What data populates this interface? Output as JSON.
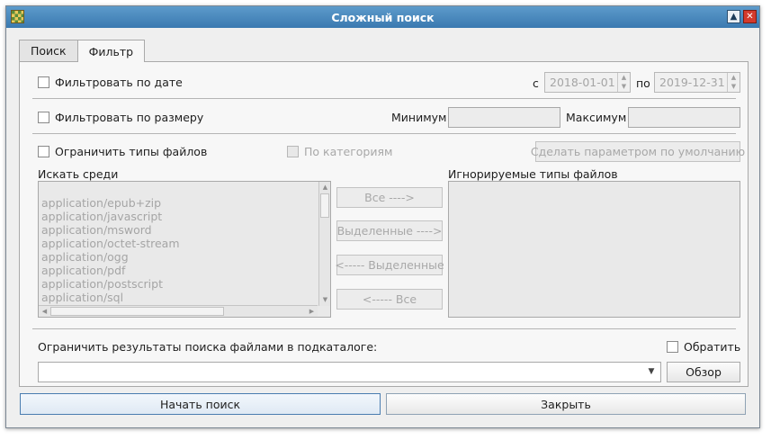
{
  "window": {
    "title": "Сложный поиск",
    "maximize_icon": "arrow-up-icon",
    "close_icon": "close-icon"
  },
  "tabs": [
    {
      "label": "Поиск",
      "active": false
    },
    {
      "label": "Фильтр",
      "active": true
    }
  ],
  "date_filter": {
    "label": "Фильтровать по дате",
    "from_label": "с",
    "from_value": "2018-01-01",
    "to_label": "по",
    "to_value": "2019-12-31"
  },
  "size_filter": {
    "label": "Фильтровать по размеру",
    "min_label": "Минимум",
    "min_value": "",
    "max_label": "Максимум",
    "max_value": ""
  },
  "type_filter": {
    "label": "Ограничить типы файлов",
    "by_category_label": "По категориям",
    "default_button": "Сделать параметром по умолчанию"
  },
  "search_among": {
    "label": "Искать среди",
    "items": [
      "application/epub+zip",
      "application/javascript",
      "application/msword",
      "application/octet-stream",
      "application/ogg",
      "application/pdf",
      "application/postscript",
      "application/sql"
    ]
  },
  "move_buttons": {
    "all_right": "Все ---->",
    "selected_right": "Выделенные ---->",
    "selected_left": "<----- Выделенные",
    "all_left": "<----- Все"
  },
  "ignored_types": {
    "label": "Игнорируемые типы файлов"
  },
  "subdir": {
    "label": "Ограничить результаты поиска файлами в подкаталоге:",
    "invert_label": "Обратить",
    "value": "",
    "browse_button": "Обзор"
  },
  "footer": {
    "start_button": "Начать поиск",
    "close_button": "Закрыть"
  }
}
